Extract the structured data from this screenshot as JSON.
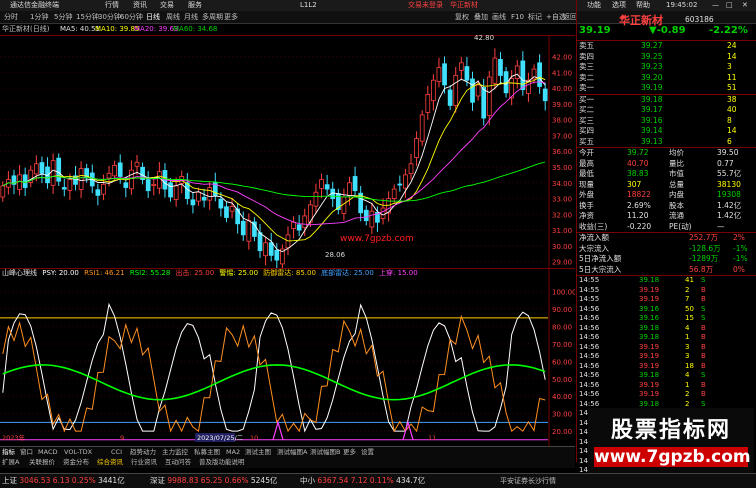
{
  "window": {
    "title": "通达信金融终端",
    "nav": [
      "行情",
      "资讯",
      "交易",
      "服务"
    ],
    "l2": "L1L2",
    "promo": [
      "交易未登录",
      "华正新材"
    ],
    "right_menu": [
      "功能",
      "选项",
      "帮助"
    ],
    "time": "19:45:02"
  },
  "menu": {
    "periods": [
      "分时",
      "1分钟",
      "5分钟",
      "15分钟",
      "30分钟",
      "60分钟",
      "日线",
      "周线",
      "月线",
      "多周期",
      "更多"
    ],
    "right": [
      "复权",
      "叠加",
      "画线",
      "F10",
      "标记",
      "+自选",
      "返回"
    ]
  },
  "chart": {
    "stock_title": "华正新材(日线)",
    "ma": [
      {
        "name": "MA5",
        "value": "40.51"
      },
      {
        "name": "MA10",
        "value": "39.85"
      },
      {
        "name": "MA20",
        "value": "39.63"
      },
      {
        "name": "MA60",
        "value": "34.68"
      }
    ],
    "y_ticks": [
      "42.00",
      "41.00",
      "40.00",
      "39.00",
      "38.00",
      "37.00",
      "36.00",
      "35.00",
      "34.00",
      "33.00",
      "32.00",
      "31.00",
      "30.00",
      "29.00"
    ],
    "high_label": "42.80",
    "low_label": "28.06",
    "watermark": "www.7gpzb.com"
  },
  "indicator": {
    "name": "山峰心理线",
    "params": [
      {
        "label": "PSY",
        "value": "20.00"
      },
      {
        "label": "RSI1",
        "value": "46.21"
      },
      {
        "label": "RSI2",
        "value": "55.28"
      },
      {
        "label": "出击",
        "value": "25.00"
      },
      {
        "label": "警惕",
        "value": "25.00"
      },
      {
        "label": "防御雷达",
        "value": "85.00"
      },
      {
        "label": "底部雷达",
        "value": "25.00"
      },
      {
        "label": "上穿",
        "value": "15.00"
      }
    ],
    "y_ticks": [
      "100.00",
      "90.00",
      "80.00",
      "70.00",
      "60.00",
      "50.00",
      "40.00",
      "30.00",
      "20.00"
    ],
    "date_label": "2023/07/25/二",
    "year_left": "2023年",
    "month_marks": [
      "9",
      "10",
      "11"
    ]
  },
  "tabs": {
    "row1": [
      "指标",
      "窗口",
      "MACD",
      "VOL-TDX",
      "CCI",
      "趋势动力",
      "主力监控",
      "私募主图",
      "MA2",
      "测试主图",
      "测试幅图A",
      "测试幅图B",
      "更多",
      "设置"
    ],
    "row2": [
      "扩展A",
      "关联报价",
      "资金分布",
      "综合资讯",
      "行业资讯",
      "互动问答",
      "普及版功能说明"
    ]
  },
  "quote": {
    "price": "39.19",
    "change": "-0.89",
    "pct": "-2.22%",
    "name": "华正新材",
    "code": "603186",
    "asks": [
      {
        "label": "卖五",
        "price": "39.27",
        "vol": "24"
      },
      {
        "label": "卖四",
        "price": "39.25",
        "vol": "14"
      },
      {
        "label": "卖三",
        "price": "39.23",
        "vol": "3"
      },
      {
        "label": "卖二",
        "price": "39.20",
        "vol": "11"
      },
      {
        "label": "卖一",
        "price": "39.19",
        "vol": "51"
      }
    ],
    "bids": [
      {
        "label": "买一",
        "price": "39.18",
        "vol": "38"
      },
      {
        "label": "买二",
        "price": "39.17",
        "vol": "40"
      },
      {
        "label": "买三",
        "price": "39.16",
        "vol": "8"
      },
      {
        "label": "买四",
        "price": "39.14",
        "vol": "14"
      },
      {
        "label": "买五",
        "price": "39.13",
        "vol": "6"
      }
    ],
    "stats": [
      {
        "l1": "今开",
        "v1": "39.72",
        "l2": "均价",
        "v2": "39.50"
      },
      {
        "l1": "最高",
        "v1": "40.70",
        "l2": "量比",
        "v2": "0.77"
      },
      {
        "l1": "最低",
        "v1": "38.83",
        "l2": "市值",
        "v2": "55.7亿"
      },
      {
        "l1": "现量",
        "v1": "307",
        "l2": "总量",
        "v2": "38130"
      },
      {
        "l1": "外盘",
        "v1": "18822",
        "l2": "内盘",
        "v2": "19308"
      },
      {
        "l1": "换手",
        "v1": "2.69%",
        "l2": "股本",
        "v2": "1.42亿"
      },
      {
        "l1": "净资",
        "v1": "11.20",
        "l2": "流通",
        "v2": "1.42亿"
      },
      {
        "l1": "收益(三)",
        "v1": "-0.220",
        "l2": "PE(动)",
        "v2": "—"
      }
    ],
    "flows": [
      {
        "label": "净流入额",
        "value": "252.7万",
        "pct": "2%"
      },
      {
        "label": "大宗流入",
        "value": "-128.6万",
        "pct": "-1%"
      },
      {
        "label": "5日净流入额",
        "value": "-1289万",
        "pct": "-1%"
      },
      {
        "label": "5日大宗流入",
        "value": "56.8万",
        "pct": "0%"
      }
    ],
    "ticks": [
      {
        "t": "14:55",
        "p": "39.18",
        "v": "41",
        "s": "S"
      },
      {
        "t": "14:55",
        "p": "39.19",
        "v": "2",
        "s": "B"
      },
      {
        "t": "14:55",
        "p": "39.19",
        "v": "7",
        "s": "B"
      },
      {
        "t": "14:56",
        "p": "39.16",
        "v": "50",
        "s": "S"
      },
      {
        "t": "14:56",
        "p": "39.16",
        "v": "15",
        "s": "S"
      },
      {
        "t": "14:56",
        "p": "39.18",
        "v": "4",
        "s": "B"
      },
      {
        "t": "14:56",
        "p": "39.18",
        "v": "1",
        "s": "B"
      },
      {
        "t": "14:56",
        "p": "39.19",
        "v": "3",
        "s": "B"
      },
      {
        "t": "14:56",
        "p": "39.19",
        "v": "3",
        "s": "B"
      },
      {
        "t": "14:56",
        "p": "39.19",
        "v": "18",
        "s": "B"
      },
      {
        "t": "14:56",
        "p": "39.18",
        "v": "4",
        "s": "S"
      },
      {
        "t": "14:56",
        "p": "39.19",
        "v": "1",
        "s": "B"
      },
      {
        "t": "14:56",
        "p": "39.19",
        "v": "2",
        "s": "B"
      },
      {
        "t": "14:56",
        "p": "39.18",
        "v": "2",
        "s": "S"
      },
      {
        "t": "14:56",
        "p": "39.19",
        "v": "2",
        "s": "B"
      },
      {
        "t": "14:56",
        "p": "39.17",
        "v": "11",
        "s": "S"
      },
      {
        "t": "14:56",
        "p": "39.17",
        "v": "4",
        "s": "S"
      },
      {
        "t": "14:56",
        "p": "39.17",
        "v": "8",
        "s": "S"
      },
      {
        "t": "14:56",
        "p": "39.18",
        "v": "17",
        "s": "B"
      },
      {
        "t": "14:56",
        "p": "39.17",
        "v": "2",
        "s": "S"
      },
      {
        "t": "14:56",
        "p": "39.19",
        "v": "6",
        "s": "B"
      }
    ],
    "bottom_tabs": [
      "细",
      "分",
      "笔",
      "价",
      "竞",
      "势"
    ]
  },
  "status": [
    {
      "name": "上证",
      "value": "3046.53",
      "chg": "6.13",
      "pct": "0.25%",
      "amt": "3441亿"
    },
    {
      "name": "深证",
      "value": "9988.83",
      "chg": "65.25",
      "pct": "0.66%",
      "amt": "5245亿"
    },
    {
      "name": "中小",
      "value": "6367.54",
      "chg": "7.12",
      "pct": "0.11%",
      "amt": "434.7亿"
    }
  ],
  "status_right": "平安证券长沙行情",
  "banner": {
    "title": "股票指标网",
    "url": "www.7gpzb.com"
  },
  "colors": {
    "up": "#ff4040",
    "down": "#00d000",
    "ma5": "#ffffff",
    "ma10": "#ffff00",
    "ma20": "#ff40ff",
    "ma60": "#00ff00",
    "psy": "#ff9020",
    "rsi1": "#ffffff",
    "rsi2": "#00ff00",
    "line85": "#ffd000",
    "line25": "#40a0ff",
    "line15": "#ff40ff"
  }
}
